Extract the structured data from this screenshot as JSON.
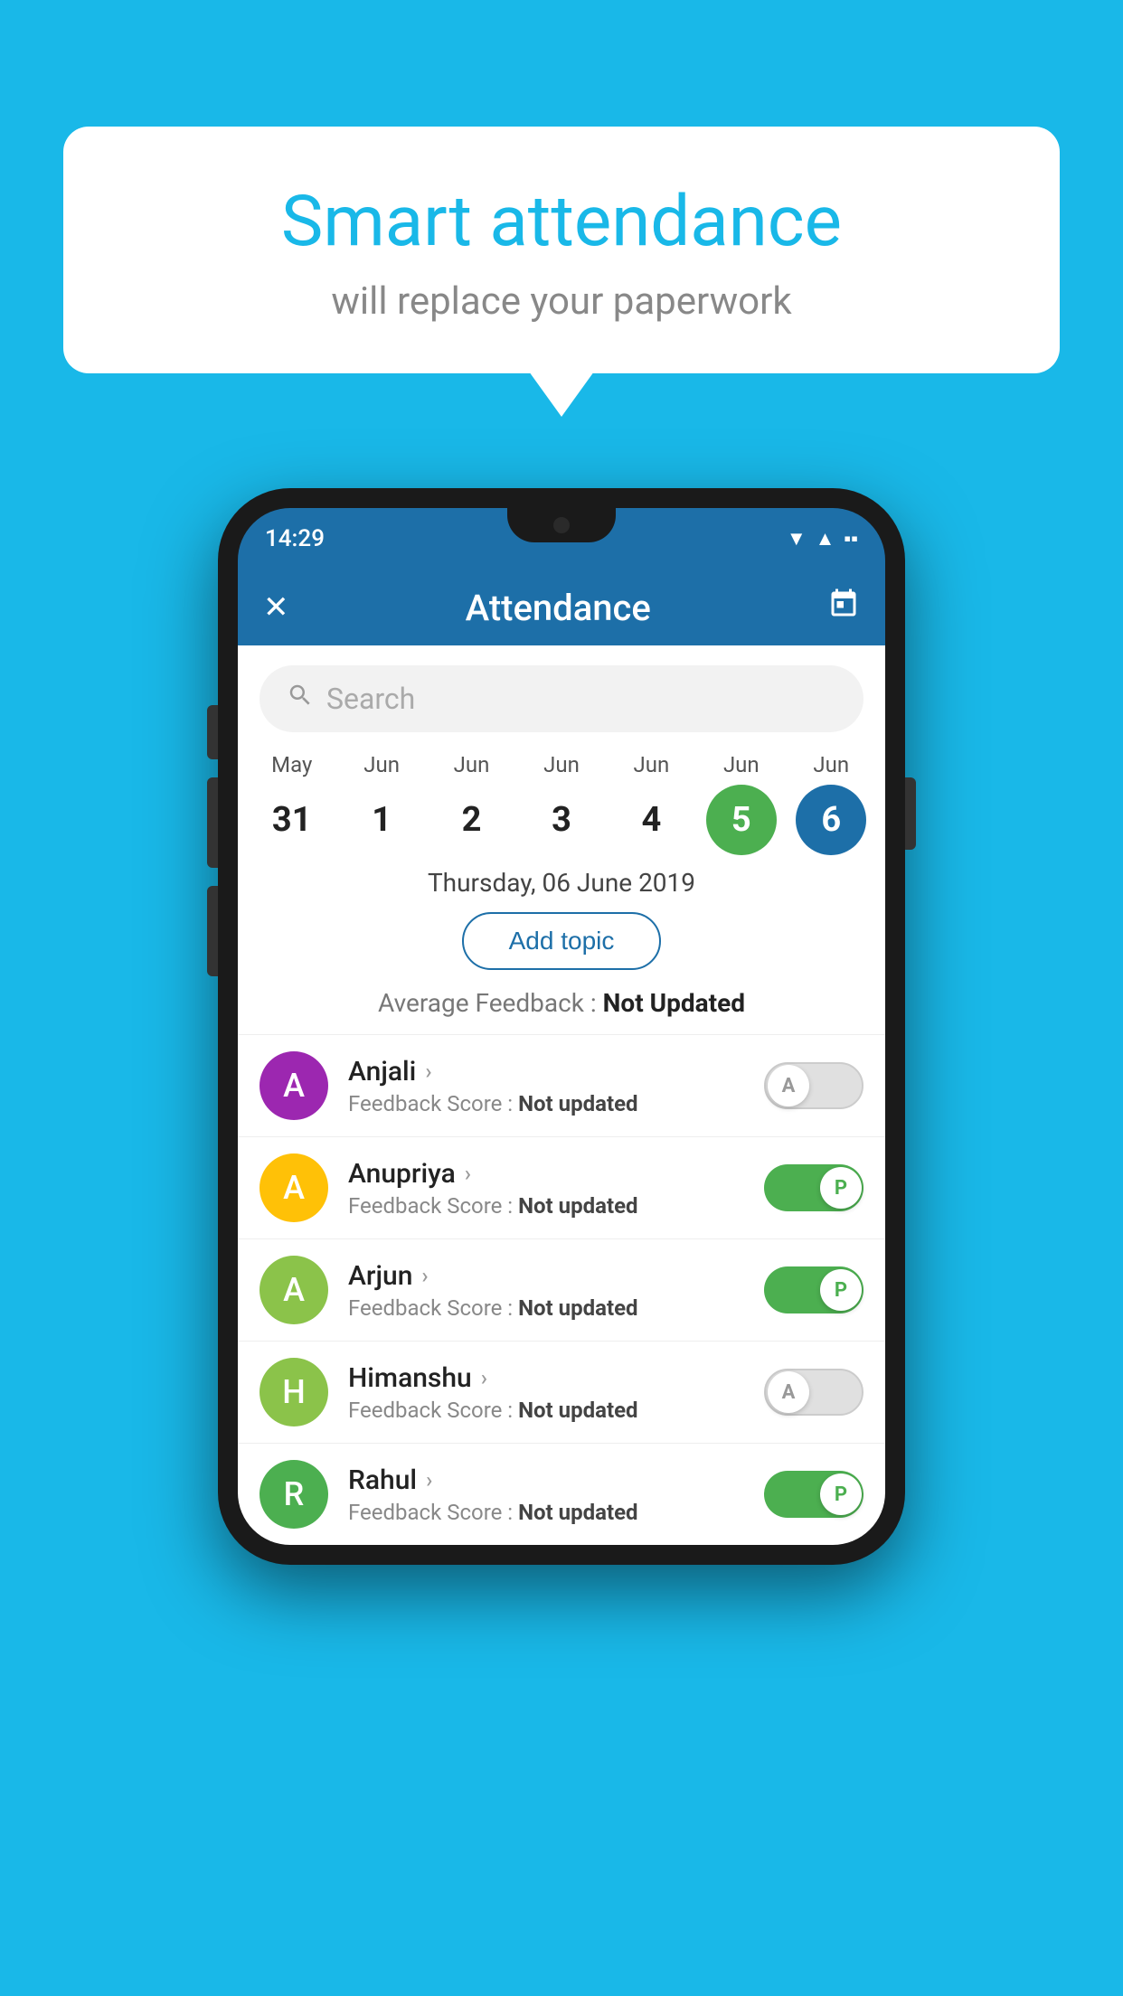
{
  "background_color": "#19B8E8",
  "speech_bubble": {
    "title": "Smart attendance",
    "subtitle": "will replace your paperwork"
  },
  "status_bar": {
    "time": "14:29",
    "icons": [
      "▼",
      "▲",
      "▪"
    ]
  },
  "toolbar": {
    "title": "Attendance",
    "close_label": "✕",
    "calendar_icon": "📅"
  },
  "search": {
    "placeholder": "Search"
  },
  "calendar": {
    "days": [
      {
        "month": "May",
        "date": "31",
        "state": "normal"
      },
      {
        "month": "Jun",
        "date": "1",
        "state": "normal"
      },
      {
        "month": "Jun",
        "date": "2",
        "state": "normal"
      },
      {
        "month": "Jun",
        "date": "3",
        "state": "normal"
      },
      {
        "month": "Jun",
        "date": "4",
        "state": "normal"
      },
      {
        "month": "Jun",
        "date": "5",
        "state": "active-green"
      },
      {
        "month": "Jun",
        "date": "6",
        "state": "active-blue"
      }
    ]
  },
  "selected_date": "Thursday, 06 June 2019",
  "add_topic_label": "Add topic",
  "avg_feedback_label": "Average Feedback :",
  "avg_feedback_value": "Not Updated",
  "students": [
    {
      "name": "Anjali",
      "initial": "A",
      "avatar_color": "#9C27B0",
      "feedback_label": "Feedback Score :",
      "feedback_value": "Not updated",
      "toggle_state": "off",
      "toggle_letter": "A"
    },
    {
      "name": "Anupriya",
      "initial": "A",
      "avatar_color": "#FFC107",
      "feedback_label": "Feedback Score :",
      "feedback_value": "Not updated",
      "toggle_state": "on-green",
      "toggle_letter": "P"
    },
    {
      "name": "Arjun",
      "initial": "A",
      "avatar_color": "#8BC34A",
      "feedback_label": "Feedback Score :",
      "feedback_value": "Not updated",
      "toggle_state": "on-green",
      "toggle_letter": "P"
    },
    {
      "name": "Himanshu",
      "initial": "H",
      "avatar_color": "#8BC34A",
      "feedback_label": "Feedback Score :",
      "feedback_value": "Not updated",
      "toggle_state": "off",
      "toggle_letter": "A"
    },
    {
      "name": "Rahul",
      "initial": "R",
      "avatar_color": "#4CAF50",
      "feedback_label": "Feedback Score :",
      "feedback_value": "Not updated",
      "toggle_state": "on-green",
      "toggle_letter": "P"
    }
  ]
}
